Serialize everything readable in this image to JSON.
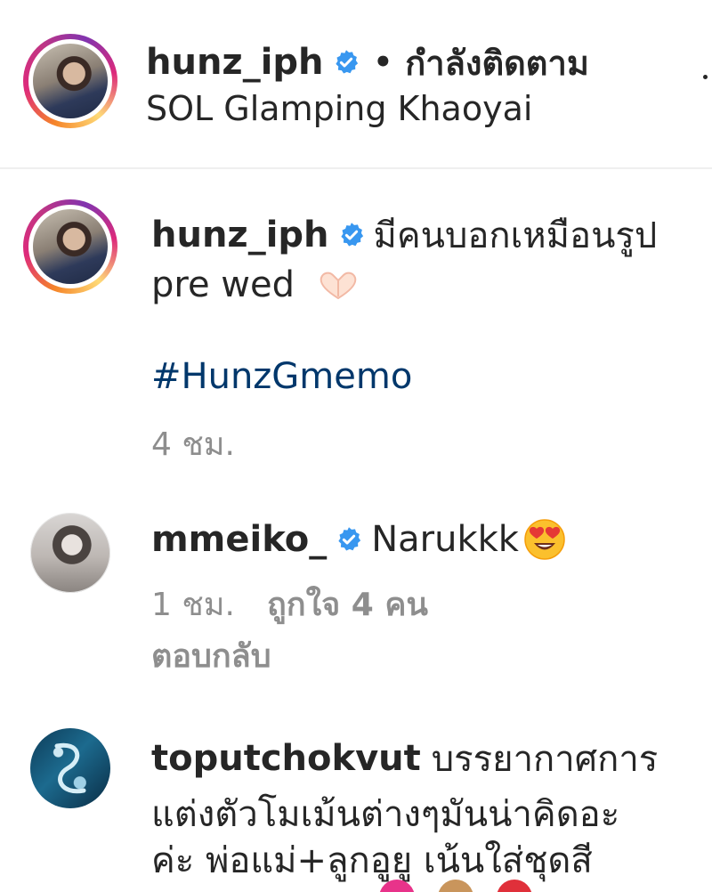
{
  "header": {
    "username": "hunz_iph",
    "separator": "•",
    "follow_status": "กำลังติดตาม",
    "location": "SOL Glamping Khaoyai"
  },
  "caption": {
    "username": "hunz_iph",
    "text_line1": "มีคนบอกเหมือนรูป",
    "text_line2": "pre wed",
    "hashtag": "#HunzGmemo",
    "time": "4 ชม."
  },
  "comments": [
    {
      "username": "mmeiko_",
      "text": "Narukkk",
      "time": "1 ชม.",
      "likes": "ถูกใจ 4 คน",
      "reply": "ตอบกลับ"
    },
    {
      "username": "toputchokvut",
      "text_line1": "บรรยากาศการ",
      "text_line2": "แต่งตัวโมเม้นต่างๆมันน่าคิดอะ",
      "text_line3": "ค่ะ พ่อแม่+ลูกอูยู เน้นใส่ชุดสี"
    }
  ],
  "icons": {
    "verified": "verified-badge-icon",
    "heart_hands": "heart-hands-emoji-icon",
    "heart_eyes": "heart-eyes-emoji-icon"
  },
  "colors": {
    "verified_blue": "#3897f0",
    "hashtag_blue": "#00376b",
    "meta_gray": "#8e8e8e"
  }
}
